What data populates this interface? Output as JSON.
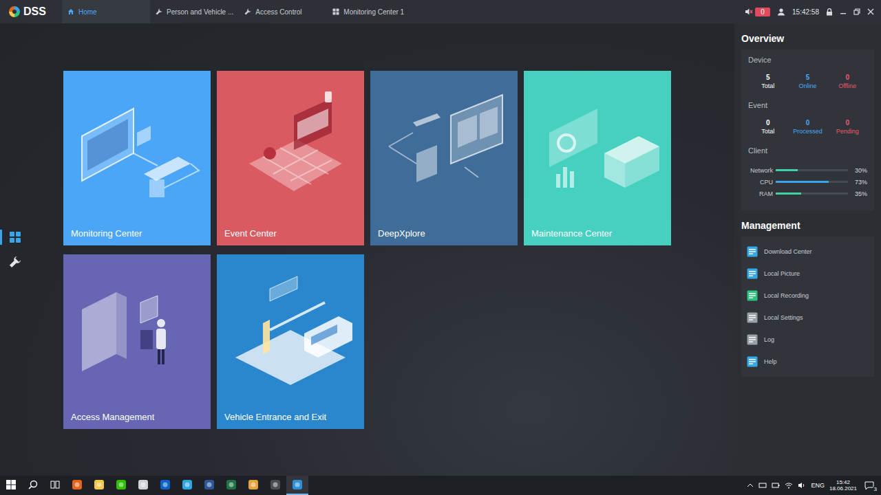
{
  "app": {
    "logo": "DSS"
  },
  "tabs": [
    {
      "label": "Home",
      "kind": "home",
      "selected": true
    },
    {
      "label": "Person and Vehicle ...",
      "kind": "tool",
      "selected": false
    },
    {
      "label": "Access Control",
      "kind": "tool",
      "selected": false
    },
    {
      "label": "Monitoring Center 1",
      "kind": "grid",
      "selected": false
    }
  ],
  "header_status": {
    "alarm_count": "0",
    "time": "15:42:58"
  },
  "rail": [
    {
      "kind": "grid",
      "selected": true
    },
    {
      "kind": "tool",
      "selected": false
    }
  ],
  "tiles": [
    {
      "label": "Monitoring Center",
      "kind": "monitor",
      "color": "#4ba6f7"
    },
    {
      "label": "Event Center",
      "kind": "map",
      "color": "#da5a62"
    },
    {
      "label": "DeepXplore",
      "kind": "explore",
      "color": "#3f6c99"
    },
    {
      "label": "Maintenance Center",
      "kind": "report",
      "color": "#45d0c0"
    },
    {
      "label": "Access Management",
      "kind": "door",
      "color": "#6666b2"
    },
    {
      "label": "Vehicle Entrance and Exit",
      "kind": "gate",
      "color": "#2b87cd"
    }
  ],
  "overview": {
    "title": "Overview",
    "sections": [
      {
        "title": "Device",
        "stats": [
          {
            "value": "5",
            "label": "Total",
            "color": "#ffffff"
          },
          {
            "value": "5",
            "label": "Online",
            "color": "#4aa8f5"
          },
          {
            "value": "0",
            "label": "Offline",
            "color": "#f0566a"
          }
        ]
      },
      {
        "title": "Event",
        "stats": [
          {
            "value": "0",
            "label": "Total",
            "color": "#ffffff"
          },
          {
            "value": "0",
            "label": "Processed",
            "color": "#4aa8f5"
          },
          {
            "value": "0",
            "label": "Pending",
            "color": "#f0566a"
          }
        ]
      }
    ],
    "client": {
      "title": "Client",
      "meters": [
        {
          "label": "Network",
          "level": 0.3,
          "reading": "30%",
          "color": "#3ed1a3"
        },
        {
          "label": "CPU",
          "level": 0.73,
          "reading": "73%",
          "color": "#3aa6ea"
        },
        {
          "label": "RAM",
          "level": 0.35,
          "reading": "35%",
          "color": "#3ed1a3"
        }
      ]
    }
  },
  "management": {
    "title": "Management",
    "items": [
      {
        "label": "Download Center",
        "color": "#38a9e0"
      },
      {
        "label": "Local Picture",
        "color": "#38a9e0"
      },
      {
        "label": "Local Recording",
        "color": "#2ec27e"
      },
      {
        "label": "Local Settings",
        "color": "#9aa0a8"
      },
      {
        "label": "Log",
        "color": "#9aa0a8"
      },
      {
        "label": "Help",
        "color": "#38a9e0"
      }
    ]
  },
  "taskbar": {
    "apps": [
      {
        "kind": "start",
        "selected": false
      },
      {
        "kind": "search",
        "selected": false
      },
      {
        "kind": "taskview",
        "selected": false
      },
      {
        "kind": "app",
        "color": "#e8641b",
        "selected": false
      },
      {
        "kind": "app",
        "color": "#f2c94c",
        "selected": false
      },
      {
        "kind": "app",
        "color": "#2dc100",
        "selected": false
      },
      {
        "kind": "app",
        "color": "#cfd3d8",
        "selected": false
      },
      {
        "kind": "app",
        "color": "#0a64c8",
        "selected": false
      },
      {
        "kind": "app",
        "color": "#2ca5e0",
        "selected": false
      },
      {
        "kind": "app",
        "color": "#2b5797",
        "selected": false
      },
      {
        "kind": "app",
        "color": "#1f7244",
        "selected": false
      },
      {
        "kind": "app",
        "color": "#e8a33c",
        "selected": false
      },
      {
        "kind": "app",
        "color": "#4a4d52",
        "selected": false
      },
      {
        "kind": "app",
        "color": "#2e8fd6",
        "selected": true
      }
    ],
    "tray": {
      "language": "ENG",
      "time": "15:42",
      "date": "18.06.2021",
      "notifications": "3"
    }
  }
}
